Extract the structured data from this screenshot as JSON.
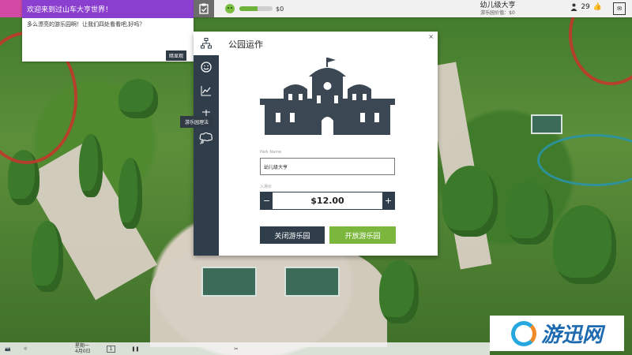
{
  "welcome": {
    "title": "欢迎来到过山车大亨世界！",
    "body": "多么漂亮的游乐园啊！让我们四处看看吧,好吗？",
    "tag": "暗显观"
  },
  "topbar": {
    "money": "$0",
    "park_name": "幼儿级大亨",
    "park_sub": "游乐园价值：$0",
    "guests": "29",
    "rating_fraction": 0.55
  },
  "dialog": {
    "title": "公园运作",
    "tooltip": "游乐园理法",
    "name_label": "Park Name",
    "name_value": "幼儿级大亨",
    "price_label": "入场价",
    "price": "$12.00",
    "minus": "−",
    "plus": "+",
    "close_btn": "关闭游乐园",
    "open_btn": "开放游乐园",
    "close_x": "×"
  },
  "bottombar": {
    "date_line1": "星期一",
    "date_line2": "4月0日",
    "speed": "1"
  },
  "logo": {
    "text": "游迅网"
  },
  "colors": {
    "sidebar": "#2f3e4a",
    "open_green": "#7cb73d",
    "welcome_purple": "#8b3fcf"
  }
}
